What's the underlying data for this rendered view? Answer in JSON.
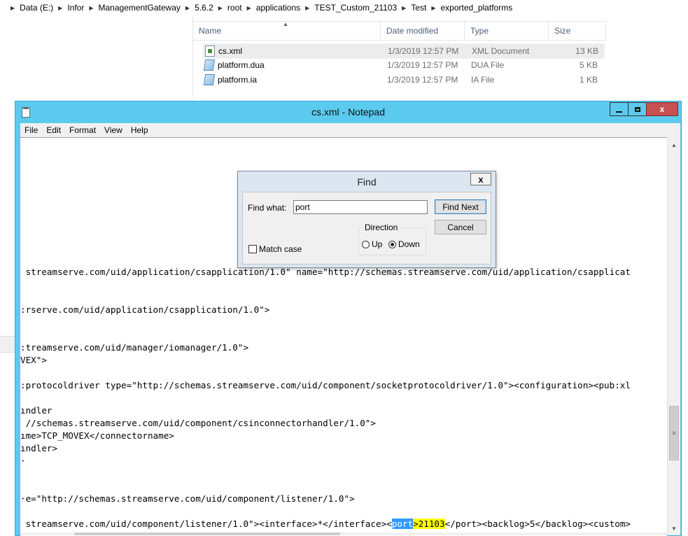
{
  "explorer": {
    "breadcrumb": [
      "Data (E:)",
      "Infor",
      "ManagementGateway",
      "5.6.2",
      "root",
      "applications",
      "TEST_Custom_21103",
      "Test",
      "exported_platforms"
    ],
    "columns": {
      "name": "Name",
      "date": "Date modified",
      "type": "Type",
      "size": "Size"
    },
    "files": [
      {
        "name": "cs.xml",
        "date": "1/3/2019 12:57 PM",
        "type": "XML Document",
        "size": "13 KB",
        "icon": "xml-file-icon",
        "selected": true
      },
      {
        "name": "platform.dua",
        "date": "1/3/2019 12:57 PM",
        "type": "DUA File",
        "size": "5 KB",
        "icon": "generic-file-icon",
        "selected": false
      },
      {
        "name": "platform.ia",
        "date": "1/3/2019 12:57 PM",
        "type": "IA File",
        "size": "1 KB",
        "icon": "generic-file-icon",
        "selected": false
      }
    ]
  },
  "notepad": {
    "title": "cs.xml - Notepad",
    "close_glyph": "x",
    "menu": [
      "File",
      "Edit",
      "Format",
      "View",
      "Help"
    ],
    "lines": [
      " streamserve.com/uid/application/csapplication/1.0\" name=\"http://schemas.streamserve.com/uid/application/csapplicat",
      ":rserve.com/uid/application/csapplication/1.0\">",
      ":treamserve.com/uid/manager/iomanager/1.0\">",
      "VEX\">",
      ":protocoldriver type=\"http://schemas.streamserve.com/uid/component/socketprotocoldriver/1.0\"><configuration><pub:xl",
      "ındler",
      " //schemas.streamserve.com/uid/component/csinconnectorhandler/1.0\">",
      "ıme>TCP_MOVEX</connectorname>",
      "ındler>",
      "·",
      "·e=\"http://schemas.streamserve.com/uid/component/listener/1.0\">"
    ],
    "last_line": {
      "before": " streamserve.com/uid/component/listener/1.0\"><interface>*</interface><",
      "selected": "port",
      "gt": ">",
      "port_value": "21103",
      "after": "</port><backlog>5</backlog><custom>"
    }
  },
  "find_dialog": {
    "title": "Find",
    "close_glyph": "x",
    "find_what_label": "Find what:",
    "find_what_value": "port",
    "find_next_label": "Find Next",
    "cancel_label": "Cancel",
    "direction_label": "Direction",
    "up_label": "Up",
    "down_label": "Down",
    "direction_selected": "Down",
    "match_case_label": "Match case",
    "match_case_checked": false
  }
}
